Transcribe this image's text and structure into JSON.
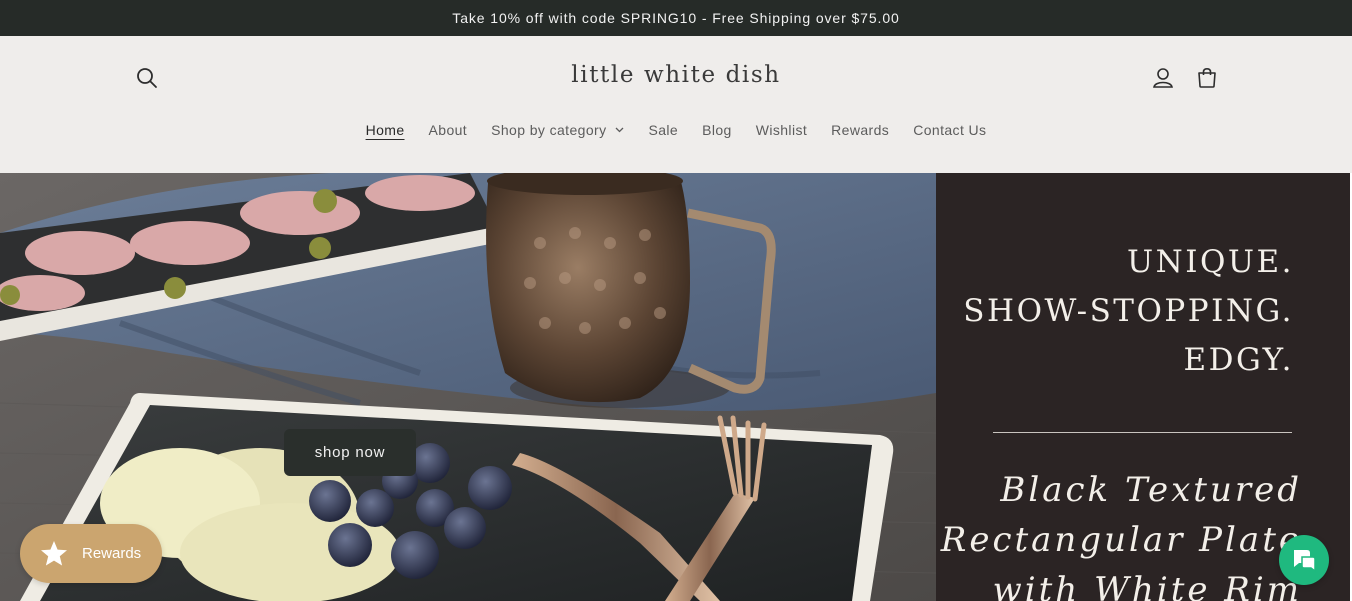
{
  "announcement": {
    "text": "Take 10% off with code SPRING10 - Free Shipping over $75.00"
  },
  "header": {
    "logo": "little white dish",
    "icons": {
      "search": "search-icon",
      "account": "account-icon",
      "cart": "cart-icon"
    },
    "nav": [
      {
        "label": "Home",
        "active": true
      },
      {
        "label": "About"
      },
      {
        "label": "Shop by category",
        "has_dropdown": true
      },
      {
        "label": "Sale"
      },
      {
        "label": "Blog"
      },
      {
        "label": "Wishlist"
      },
      {
        "label": "Rewards"
      },
      {
        "label": "Contact Us"
      }
    ]
  },
  "hero": {
    "tagline": [
      "UNIQUE.",
      "SHOW-STOPPING.",
      "EDGY."
    ],
    "product_lines": [
      "Black Textured",
      "Rectangular Plate",
      "with White Rim"
    ],
    "cta_label": "shop now"
  },
  "widgets": {
    "rewards_label": "Rewards",
    "rewards_icon": "star-icon",
    "chat_icon": "chat-icon"
  },
  "colors": {
    "announcement_bg": "#262b28",
    "header_bg": "#efedeb",
    "panel_bg": "#2b2424",
    "cta_bg": "#2a2f2c",
    "rewards_bg": "#cba56f",
    "chat_bg": "#1fb97f"
  }
}
